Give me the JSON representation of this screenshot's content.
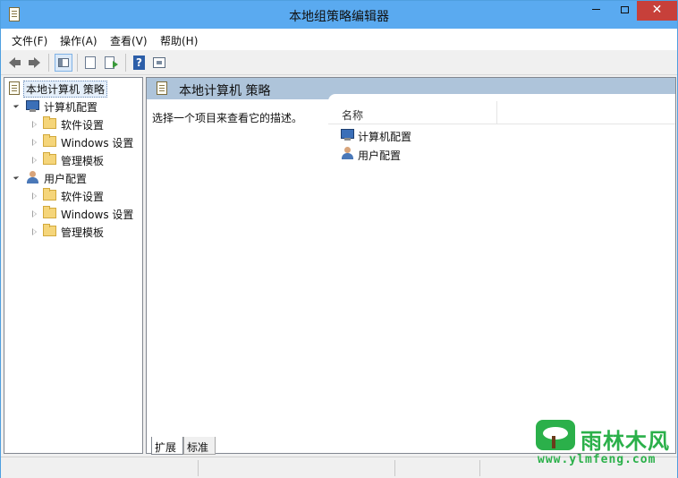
{
  "window": {
    "title": "本地组策略编辑器",
    "close_glyph": "✕"
  },
  "menu": [
    {
      "label": "文件(F)"
    },
    {
      "label": "操作(A)"
    },
    {
      "label": "查看(V)"
    },
    {
      "label": "帮助(H)"
    }
  ],
  "toolbar": {
    "help_glyph": "?"
  },
  "tree": {
    "root": "本地计算机 策略",
    "items": [
      {
        "label": "计算机配置"
      },
      {
        "label": "软件设置"
      },
      {
        "label": "Windows 设置"
      },
      {
        "label": "管理模板"
      },
      {
        "label": "用户配置"
      },
      {
        "label": "软件设置"
      },
      {
        "label": "Windows 设置"
      },
      {
        "label": "管理模板"
      }
    ]
  },
  "right_pane": {
    "header": "本地计算机 策略",
    "description": "选择一个项目来查看它的描述。",
    "column_name": "名称",
    "items": [
      {
        "label": "计算机配置"
      },
      {
        "label": "用户配置"
      }
    ]
  },
  "tabs": [
    {
      "label": "扩展"
    },
    {
      "label": "标准"
    }
  ],
  "watermark": {
    "name": "雨林木风",
    "url": "www.ylmfeng.com"
  },
  "colors": {
    "titlebar": "#5aaaf0",
    "close_button": "#c7403a",
    "pane_header": "#aec4da",
    "watermark": "#2bb04a"
  }
}
